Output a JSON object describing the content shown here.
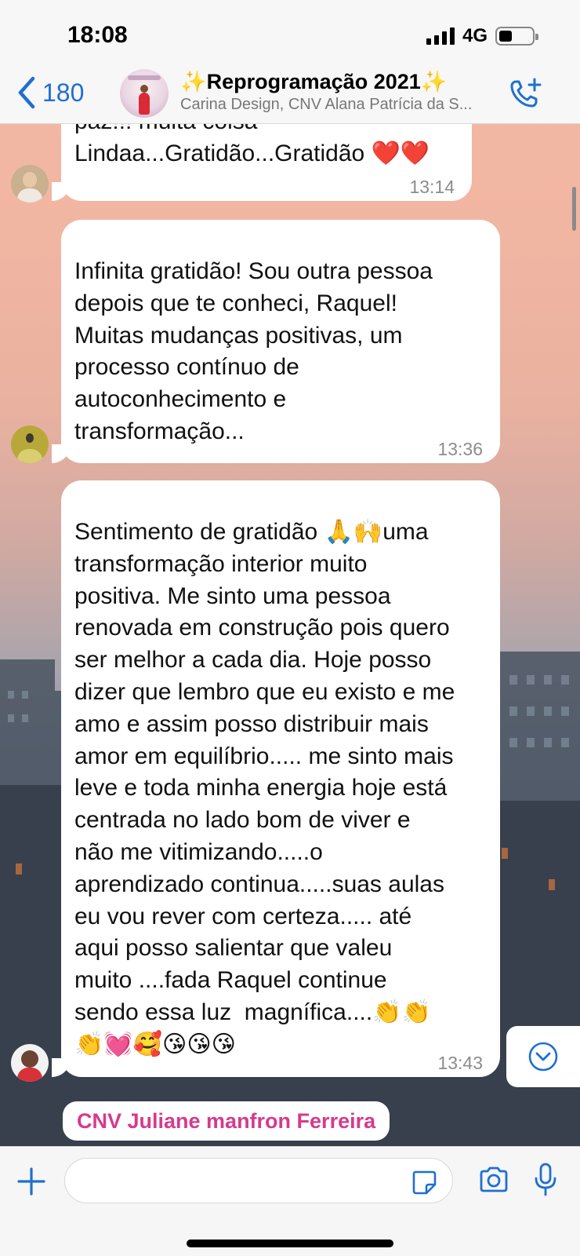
{
  "status_bar": {
    "time": "18:08",
    "network": "4G"
  },
  "header": {
    "back_count": "180",
    "group_name": "✨Reprogramação 2021✨",
    "members": "Carina Design, CNV Alana Patrícia da S..."
  },
  "messages": [
    {
      "text": "paz!!! muita coisa\nLindaa...Gratidão...Gratidão ❤️❤️",
      "time": "13:14",
      "avatar_icon": "contact-avatar-photo"
    },
    {
      "text": "Infinita gratidão! Sou outra pessoa\ndepois que te conheci, Raquel!\nMuitas mudanças positivas, um\nprocesso contínuo de\nautoconhecimento e\ntransformação...",
      "time": "13:36",
      "avatar_icon": "contact-avatar-photo"
    },
    {
      "text": "Sentimento de gratidão 🙏🙌uma\ntransformação interior muito\npositiva. Me sinto uma pessoa\nrenovada em construção pois quero\nser melhor a cada dia. Hoje posso\ndizer que lembro que eu existo e me\namo e assim posso distribuir mais\namor em equilíbrio..... me sinto mais\nleve e toda minha energia hoje está\ncentrada no lado bom de viver e\nnão me vitimizando.....o\naprendizado continua.....suas aulas\neu vou rever com certeza..... até\naqui posso salientar que valeu\nmuito ....fada Raquel continue\nsendo essa luz  magnífica....👏👏\n👏💓🥰😘😘😘",
      "time": "13:43",
      "avatar_icon": "contact-avatar-photo"
    }
  ],
  "next_sender": "CNV Juliane manfron Ferreira",
  "colors": {
    "accent_blue": "#1f6fd0",
    "sender_name_pink": "#d63a8c",
    "bubble_white": "#ffffff",
    "timestamp_gray": "#8c8c8c"
  },
  "icons": {
    "back": "chevron-left-icon",
    "call": "phone-add-icon",
    "scroll_down": "chevron-down-circle-icon",
    "plus": "plus-icon",
    "sticker": "sticker-icon",
    "camera": "camera-icon",
    "mic": "microphone-icon"
  }
}
